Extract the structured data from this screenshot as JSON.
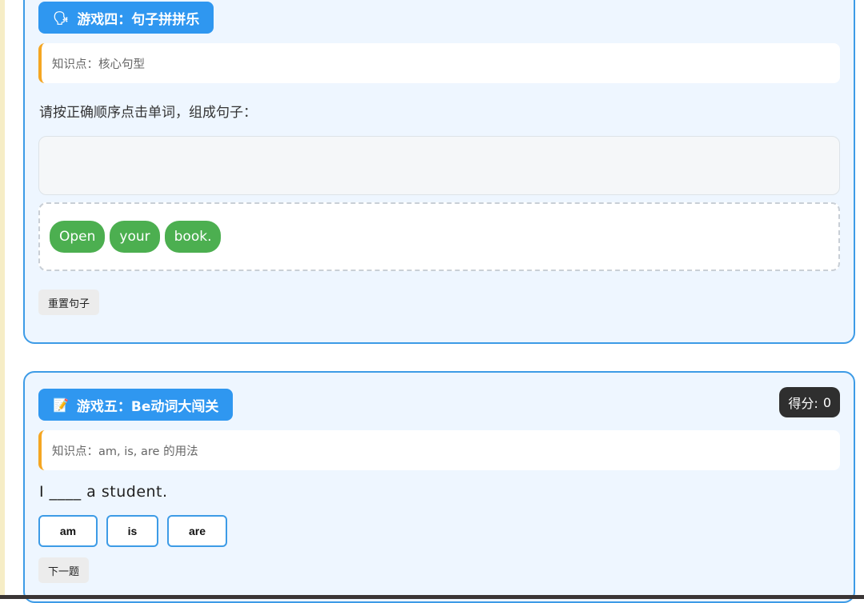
{
  "game4": {
    "icon": "🗣",
    "title": "游戏四：句子拼拼乐",
    "knowledge": "知识点：核心句型",
    "instruction": "请按正确顺序点击单词，组成句子：",
    "answer": "",
    "words": [
      "Open",
      "your",
      "book."
    ],
    "reset_label": "重置句子"
  },
  "game5": {
    "icon": "📝",
    "title": "游戏五：Be动词大闯关",
    "score_label": "得分:",
    "score_value": "0",
    "knowledge": "知识点：am, is, are 的用法",
    "question": "I ____ a student.",
    "options": [
      "am",
      "is",
      "are"
    ],
    "next_label": "下一题"
  }
}
